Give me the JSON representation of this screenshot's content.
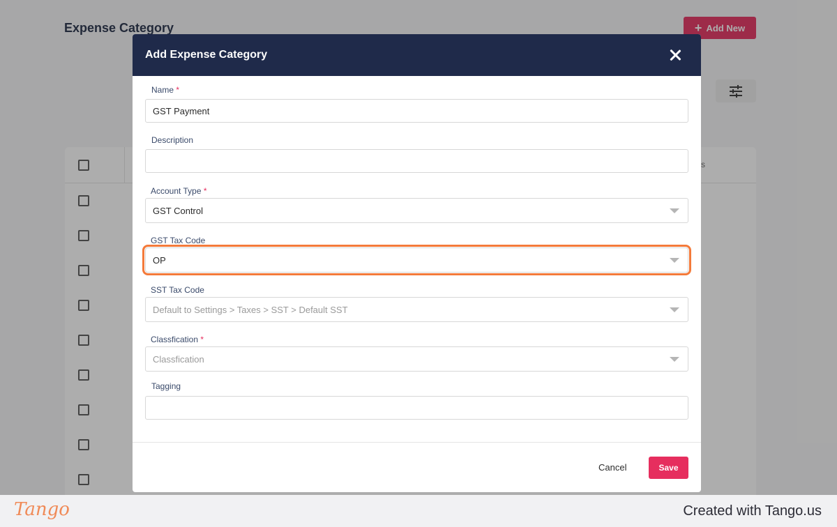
{
  "page": {
    "title": "Expense Category",
    "add_new_label": "Add New",
    "table_header_tail": "s"
  },
  "modal": {
    "title": "Add Expense Category",
    "fields": {
      "name": {
        "label": "Name",
        "required": "*",
        "value": "GST Payment"
      },
      "description": {
        "label": "Description",
        "value": ""
      },
      "account_type": {
        "label": "Account Type",
        "required": "*",
        "value": "GST Control"
      },
      "gst_tax_code": {
        "label": "GST Tax Code",
        "value": "OP"
      },
      "sst_tax_code": {
        "label": "SST Tax Code",
        "placeholder": "Default to Settings > Taxes > SST > Default SST"
      },
      "classification": {
        "label": "Classfication",
        "required": "*",
        "placeholder": "Classfication"
      },
      "tagging": {
        "label": "Tagging",
        "value": ""
      }
    },
    "cancel_label": "Cancel",
    "save_label": "Save"
  },
  "footer": {
    "logo": "Tango",
    "credit": "Created with Tango.us"
  },
  "colors": {
    "accent": "#e62e5e",
    "modal_header": "#1f2a4a",
    "highlight": "#f47a3a"
  }
}
